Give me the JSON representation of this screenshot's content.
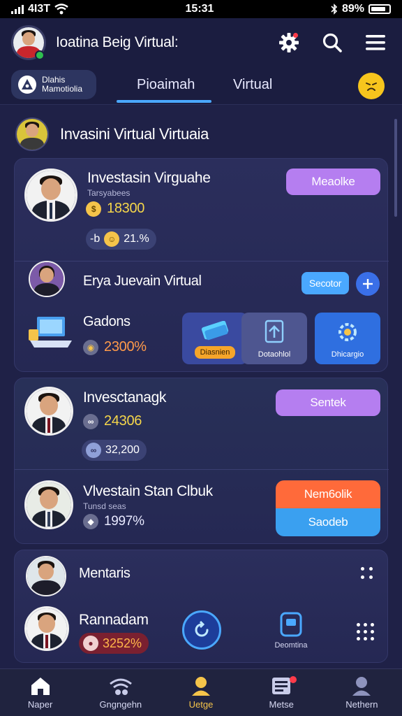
{
  "status_bar": {
    "carrier": "4I3T",
    "time": "15:31",
    "battery": "89%"
  },
  "header": {
    "title": "Ioatina Beig Virtual:"
  },
  "account": {
    "line1": "Dlahis",
    "line2": "Mamotiolia"
  },
  "tabs": [
    {
      "label": "Pioaimah",
      "active": true
    },
    {
      "label": "Virtual",
      "active": false
    }
  ],
  "section": {
    "title": "Invasini Virtual Virtuaia"
  },
  "card_a": {
    "name": "Investasin Virguahe",
    "subtitle": "Tarsyabees",
    "balance": "18300",
    "chip_prefix": "-b",
    "chip_value": "21.%",
    "button": "Meaolke",
    "sub_name": "Erya Juevain Virtual",
    "sub_button": "Secotor",
    "gadget_label": "Gadons",
    "gadget_value": "2300%",
    "tiles": [
      {
        "label": "Diasnien"
      },
      {
        "label": "Dotaohlol"
      },
      {
        "label": "Dhicargio"
      }
    ]
  },
  "card_b": {
    "name1": "Invesctanagk",
    "value1": "24306",
    "chip_value": "32,200",
    "button1": "Sentek",
    "name2": "Vlvestain Stan Clbuk",
    "subtitle2": "Tunsd seas",
    "value2": "1997%",
    "button_top": "Nem6olik",
    "button_bottom": "Saodeb"
  },
  "card_c": {
    "name1": "Mentaris",
    "name2": "Rannadam",
    "value2": "3252%",
    "action_label": "Deomtina"
  },
  "bottom_nav": [
    {
      "label": "Naper",
      "icon": "home-icon",
      "active": false
    },
    {
      "label": "Gngngehn",
      "icon": "wifi-icon",
      "active": false
    },
    {
      "label": "Uetge",
      "icon": "user-icon",
      "active": true
    },
    {
      "label": "Metse",
      "icon": "news-icon",
      "active": false
    },
    {
      "label": "Nethern",
      "icon": "person-icon",
      "active": false
    }
  ],
  "colors": {
    "background": "#1a1c3d",
    "card": "#2b2e5c",
    "accent_purple": "#b57ef0",
    "accent_blue": "#4aa8ff",
    "accent_yellow": "#f5c44a",
    "accent_orange": "#ff6a3a"
  }
}
